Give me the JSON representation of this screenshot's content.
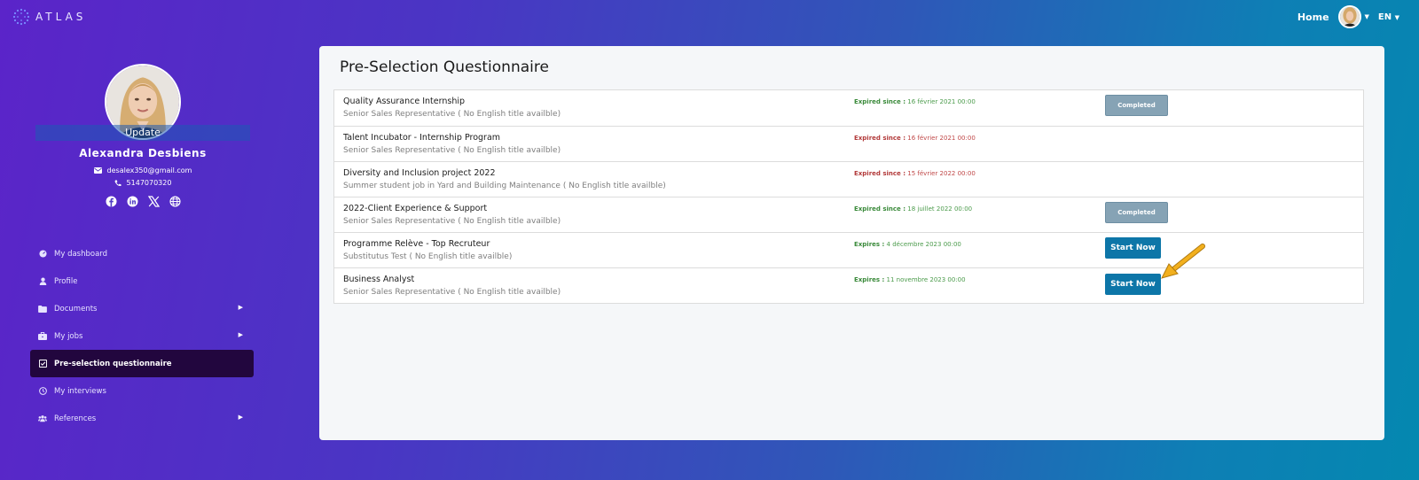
{
  "brand": {
    "logo_text": "ATLAS"
  },
  "topbar": {
    "home_label": "Home",
    "language": "EN"
  },
  "profile": {
    "update_label": "Update",
    "name": "Alexandra  Desbiens",
    "email": "desalex350@gmail.com",
    "phone": "5147070320",
    "social_icons": [
      "facebook-icon",
      "linkedin-icon",
      "x-twitter-icon",
      "globe-icon"
    ]
  },
  "nav": {
    "items": [
      {
        "label": "My dashboard",
        "icon": "dashboard-icon",
        "has_submenu": false,
        "active": false
      },
      {
        "label": "Profile",
        "icon": "user-icon",
        "has_submenu": false,
        "active": false
      },
      {
        "label": "Documents",
        "icon": "folder-icon",
        "has_submenu": true,
        "active": false
      },
      {
        "label": "My jobs",
        "icon": "briefcase-icon",
        "has_submenu": true,
        "active": false
      },
      {
        "label": "Pre-selection questionnaire",
        "icon": "checkbox-icon",
        "has_submenu": false,
        "active": true
      },
      {
        "label": "My interviews",
        "icon": "clock-icon",
        "has_submenu": false,
        "active": false
      },
      {
        "label": "References",
        "icon": "users-icon",
        "has_submenu": true,
        "active": false
      }
    ]
  },
  "main": {
    "title": "Pre-Selection Questionnaire",
    "rows": [
      {
        "title": "Quality Assurance Internship",
        "subtitle": "Senior Sales Representative ( No English title availble)",
        "expiry_label": "Expired since :",
        "expiry_date": "16 février 2021 00:00",
        "status": "ok",
        "button": "Completed"
      },
      {
        "title": "Talent Incubator - Internship Program",
        "subtitle": "Senior Sales Representative ( No English title availble)",
        "expiry_label": "Expired since :",
        "expiry_date": "16 février 2021 00:00",
        "status": "bad",
        "button": ""
      },
      {
        "title": "Diversity and Inclusion project 2022",
        "subtitle": "Summer student job in Yard and Building Maintenance ( No English title availble)",
        "expiry_label": "Expired since :",
        "expiry_date": "15 février 2022 00:00",
        "status": "bad",
        "button": ""
      },
      {
        "title": "2022-Client Experience & Support",
        "subtitle": "Senior Sales Representative ( No English title availble)",
        "expiry_label": "Expired since :",
        "expiry_date": "18 juillet 2022 00:00",
        "status": "ok",
        "button": "Completed"
      },
      {
        "title": "Programme Relève - Top Recruteur",
        "subtitle": "Substitutus Test ( No English title availble)",
        "expiry_label": "Expires :",
        "expiry_date": "4 décembre 2023 00:00",
        "status": "ok",
        "button": "Start Now"
      },
      {
        "title": "Business Analyst",
        "subtitle": "Senior Sales Representative ( No English title availble)",
        "expiry_label": "Expires :",
        "expiry_date": "11 novembre 2023 00:00",
        "status": "ok",
        "button": "Start Now"
      }
    ]
  },
  "colors": {
    "accent_button": "#0d76a8",
    "completed_button": "#86a3b5",
    "active_nav": "#22063e",
    "status_ok": "#3a8a3a",
    "status_bad": "#b23a3a",
    "pointer_arrow": "#f2b01e"
  }
}
